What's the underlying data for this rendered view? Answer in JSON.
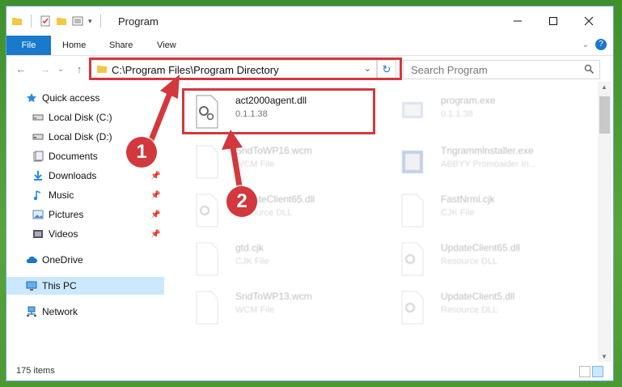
{
  "window": {
    "title": "Program",
    "controls": [
      "minimize",
      "maximize",
      "close"
    ]
  },
  "ribbon": {
    "tabs": [
      "File",
      "Home",
      "Share",
      "View"
    ]
  },
  "address": {
    "path": "C:\\Program Files\\Program Directory",
    "search_placeholder": "Search Program"
  },
  "sidebar": {
    "items": [
      {
        "label": "Quick access",
        "icon": "star-icon"
      },
      {
        "label": "Local Disk (C:)",
        "icon": "drive-icon"
      },
      {
        "label": "Local Disk (D:)",
        "icon": "drive-icon"
      },
      {
        "label": "Documents",
        "icon": "documents-icon"
      },
      {
        "label": "Downloads",
        "icon": "download-icon"
      },
      {
        "label": "Music",
        "icon": "music-icon"
      },
      {
        "label": "Pictures",
        "icon": "pictures-icon"
      },
      {
        "label": "Videos",
        "icon": "videos-icon"
      },
      {
        "label": "OneDrive",
        "icon": "cloud-icon"
      },
      {
        "label": "This PC",
        "icon": "computer-icon"
      },
      {
        "label": "Network",
        "icon": "network-icon"
      }
    ]
  },
  "files": [
    {
      "name": "act2000agent.dll",
      "sub": "0.1.1.38",
      "highlight": true
    },
    {
      "name": "program.exe",
      "sub": "0.1.1.38"
    },
    {
      "name": "SndToWP16.wcm",
      "sub": "WCM File"
    },
    {
      "name": "Tngrammlnstaller.exe",
      "sub": "ABBYY Promoaider In..."
    },
    {
      "name": "UpdateClient65.dll",
      "sub": "Resource DLL"
    },
    {
      "name": "FastNrml.cjk",
      "sub": "CJK File"
    },
    {
      "name": "gtd.cjk",
      "sub": "CJK File"
    },
    {
      "name": "UpdateClient65.dll",
      "sub": "Resource DLL"
    },
    {
      "name": "SndToWP13.wcm",
      "sub": "WCM File"
    },
    {
      "name": "UpdateClient5.dll",
      "sub": "Resource DLL"
    }
  ],
  "status": {
    "items_count": "175 items"
  },
  "annotations": {
    "step1": "1",
    "step2": "2",
    "color": "#d2383d"
  }
}
